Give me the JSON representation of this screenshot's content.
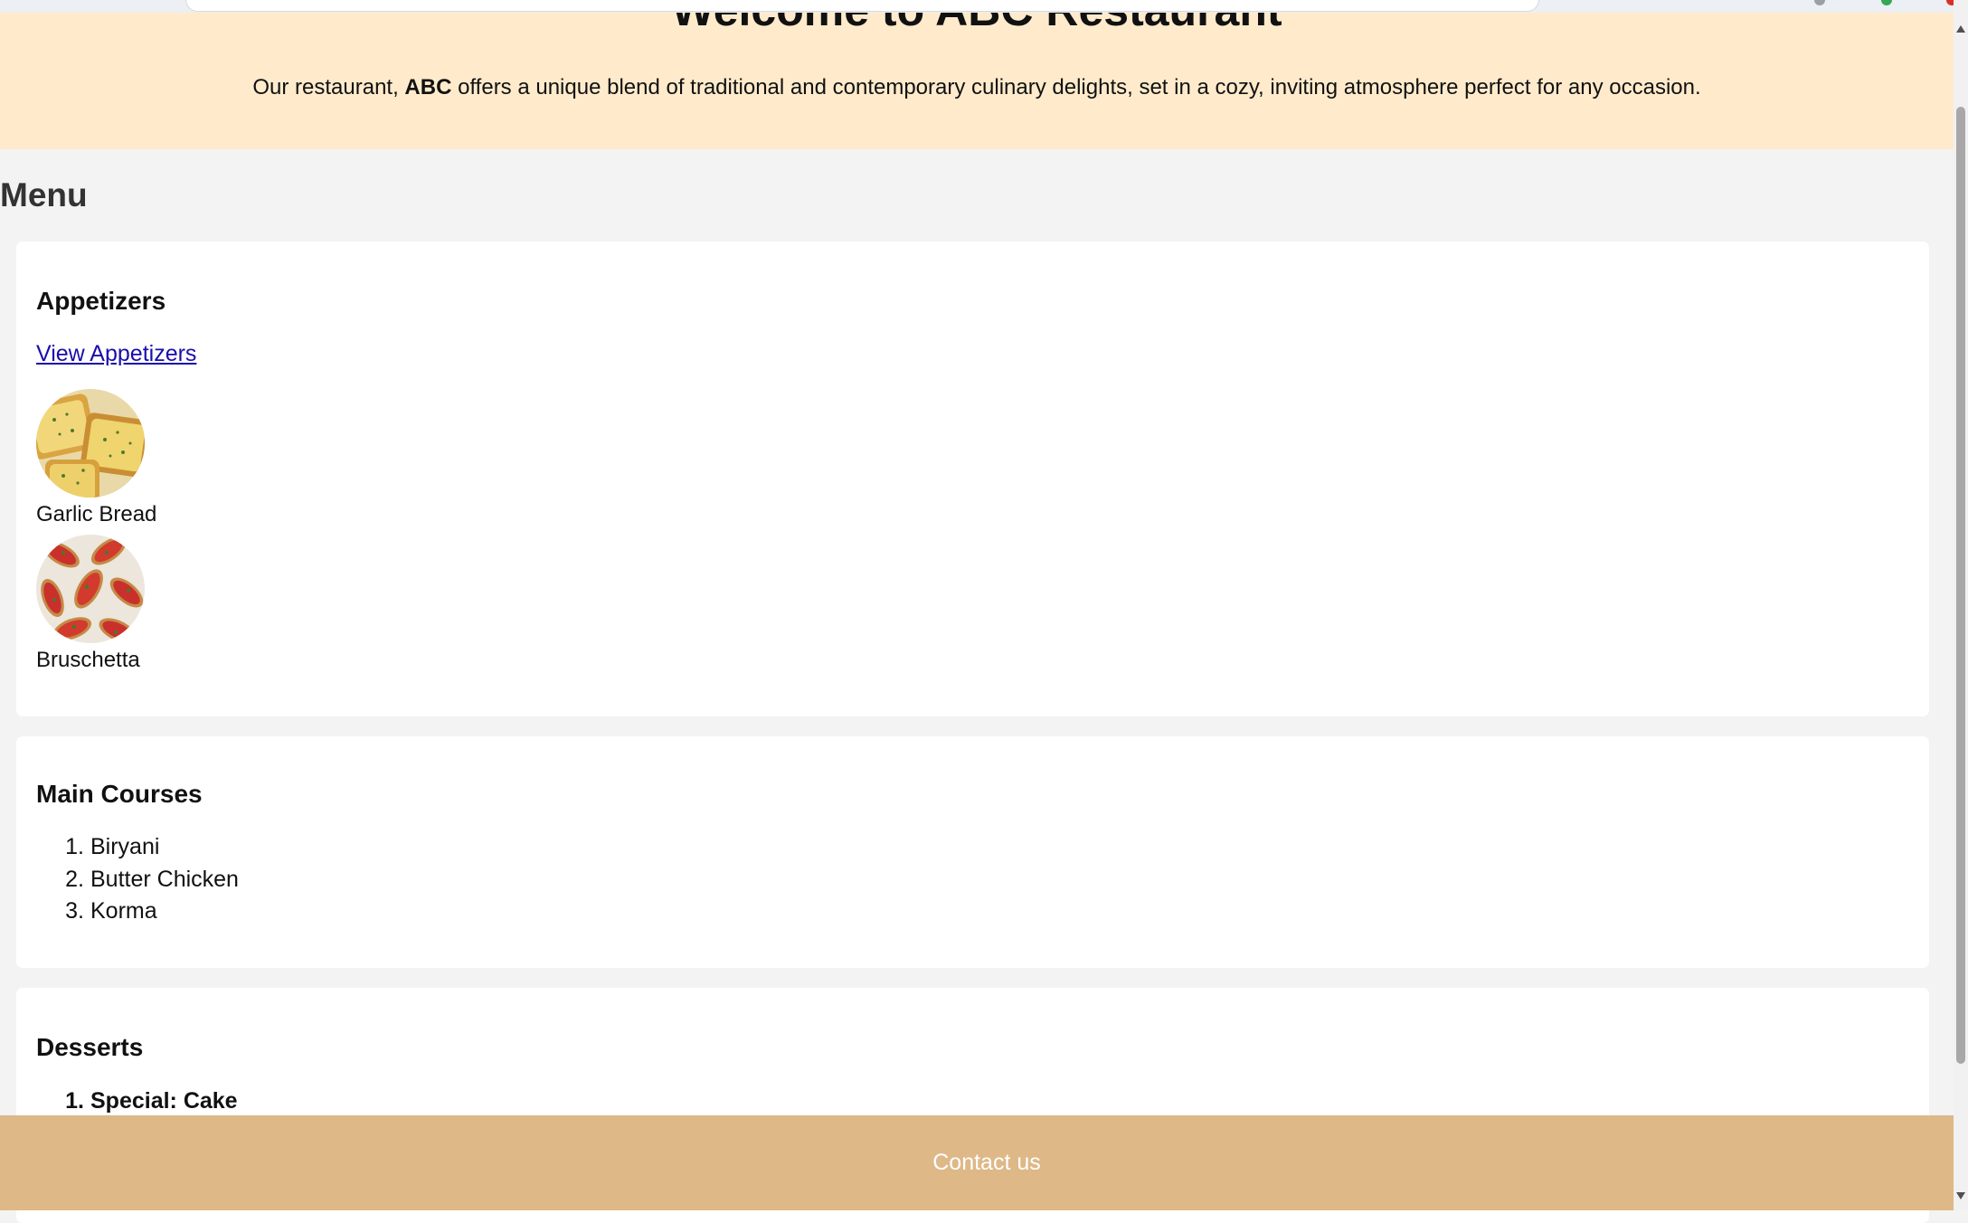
{
  "hero": {
    "title": "Welcome to ABC Restaurant",
    "intro_before": "Our restaurant, ",
    "intro_brand": "ABC",
    "intro_after": " offers a unique blend of traditional and contemporary culinary delights, set in a cozy, inviting atmosphere perfect for any occasion.",
    "background_color": "#ffebcc"
  },
  "menu": {
    "title": "Menu",
    "appetizers": {
      "heading": "Appetizers",
      "link_label": "View Appetizers",
      "items": [
        {
          "name": "Garlic Bread",
          "image": "garlic-bread-photo"
        },
        {
          "name": "Bruschetta",
          "image": "bruschetta-photo"
        }
      ]
    },
    "main_courses": {
      "heading": "Main Courses",
      "items": [
        {
          "num": "1.",
          "name": "Biryani"
        },
        {
          "num": "2.",
          "name": "Butter Chicken"
        },
        {
          "num": "3.",
          "name": "Korma"
        }
      ]
    },
    "desserts": {
      "heading": "Desserts",
      "items": [
        {
          "num": "1.",
          "name": "Special: Cake"
        }
      ],
      "special_color": "#e60000"
    }
  },
  "footer": {
    "contact_label": "Contact us",
    "background_color": "#deb887"
  }
}
